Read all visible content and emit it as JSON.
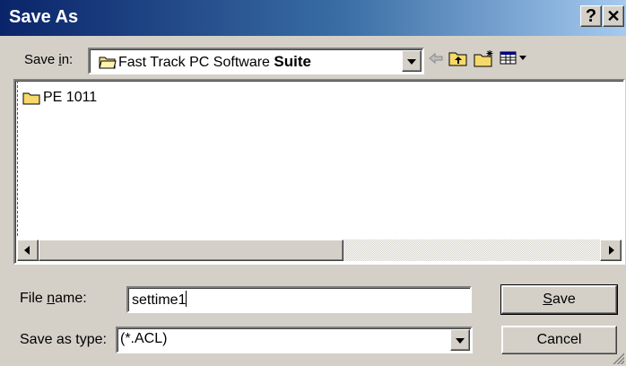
{
  "window": {
    "title": "Save As",
    "help_label": "?",
    "close_label": "✕"
  },
  "savein": {
    "label_pre": "Save ",
    "label_ul": "i",
    "label_post": "n:",
    "folder_text": "Fast Track PC Software ",
    "folder_text_bold": "Suite",
    "toolbar_icons": [
      "back-arrow-icon",
      "up-folder-icon",
      "new-folder-icon",
      "view-menu-icon"
    ]
  },
  "files": [
    {
      "name": "PE 1011",
      "icon": "folder-icon"
    }
  ],
  "filename": {
    "label_pre": "File ",
    "label_ul": "n",
    "label_post": "ame:",
    "value": "settime1"
  },
  "filetype": {
    "label": "Save as type:",
    "value": "(*.ACL)"
  },
  "buttons": {
    "save_ul": "S",
    "save_rest": "ave",
    "cancel": "Cancel"
  },
  "colors": {
    "title_start": "#0a246a",
    "title_end": "#a6caf0",
    "face": "#d4d0c8"
  }
}
